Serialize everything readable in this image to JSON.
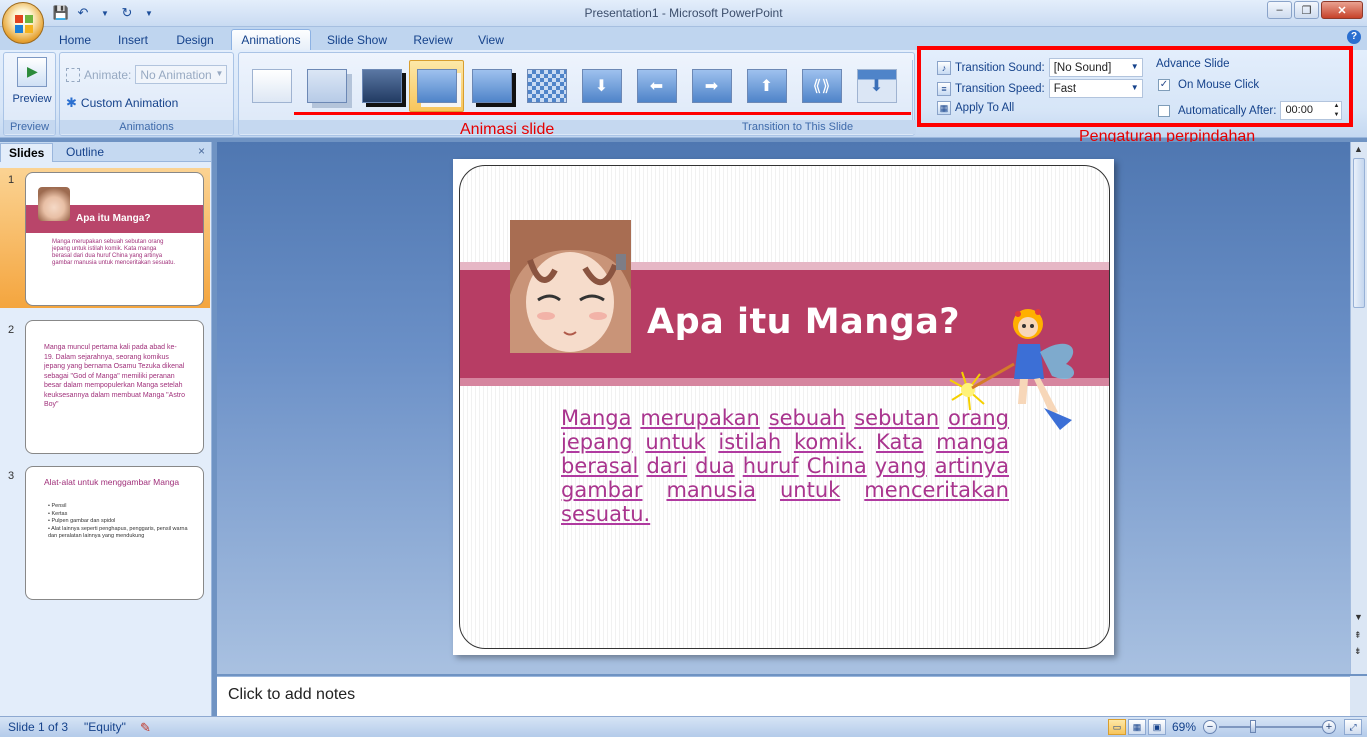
{
  "window": {
    "title": "Presentation1 - Microsoft PowerPoint"
  },
  "tabs": [
    {
      "label": "Home"
    },
    {
      "label": "Insert"
    },
    {
      "label": "Design"
    },
    {
      "label": "Animations"
    },
    {
      "label": "Slide Show"
    },
    {
      "label": "Review"
    },
    {
      "label": "View"
    }
  ],
  "active_tab": "Animations",
  "ribbon": {
    "preview": {
      "button_label": "Preview",
      "group_label": "Preview"
    },
    "animations": {
      "animate_label": "Animate:",
      "animate_value": "No Animation",
      "custom_animation_label": "Custom Animation",
      "group_label": "Animations"
    },
    "transition_group_label": "Transition to This Slide",
    "transition_sound_label": "Transition Sound:",
    "transition_sound_value": "[No Sound]",
    "transition_speed_label": "Transition Speed:",
    "transition_speed_value": "Fast",
    "apply_to_all_label": "Apply To All",
    "advance_slide_label": "Advance Slide",
    "on_mouse_click_label": "On Mouse Click",
    "on_mouse_click_checked": true,
    "auto_after_label": "Automatically After:",
    "auto_after_checked": false,
    "auto_after_value": "00:00"
  },
  "annotations": {
    "animation_label": "Animasi slide",
    "transition_settings_label": "Pengaturan perpindahan",
    "highlight_color": "#ff0000"
  },
  "slide_pane": {
    "tab_slides": "Slides",
    "tab_outline": "Outline",
    "close": "×",
    "slides": [
      {
        "number": "1",
        "title": "Apa itu Manga?",
        "text": "Manga merupakan sebuah sebutan orang jepang untuk istilah komik. Kata manga berasal dari dua huruf China yang artinya gambar manusia untuk menceritakan sesuatu."
      },
      {
        "number": "2",
        "text": "Manga muncul pertama kali pada abad ke-19. Dalam sejarahnya, seorang komikus jepang yang bernama Osamu Tezuka dikenal sebagai \"God of Manga\" memiliki peranan besar dalam mempopulerkan Manga setelah keuksesannya dalam membuat Manga \"Astro Boy\""
      },
      {
        "number": "3",
        "title": "Alat-alat untuk menggambar Manga",
        "bullets": [
          "Pensil",
          "Kertas",
          "Pulpen gambar dan spidol",
          "Alat lainnya seperti penghapus, penggaris, pensil warna dan peralatan lainnya yang mendukung"
        ]
      }
    ]
  },
  "slide": {
    "title": "Apa itu Manga?",
    "body_words": [
      "Manga",
      "merupakan",
      "sebuah",
      "sebutan",
      "orang",
      "jepang",
      "untuk",
      "istilah",
      "komik.",
      "Kata",
      "manga",
      "berasal",
      "dari",
      "dua",
      "huruf",
      "China",
      "yang",
      "artinya",
      "gambar",
      "manusia",
      "untuk",
      "menceritakan",
      "sesuatu."
    ]
  },
  "notes": {
    "placeholder": "Click to add notes"
  },
  "statusbar": {
    "slide_info": "Slide 1 of 3",
    "theme": "\"Equity\"",
    "zoom": "69%"
  }
}
